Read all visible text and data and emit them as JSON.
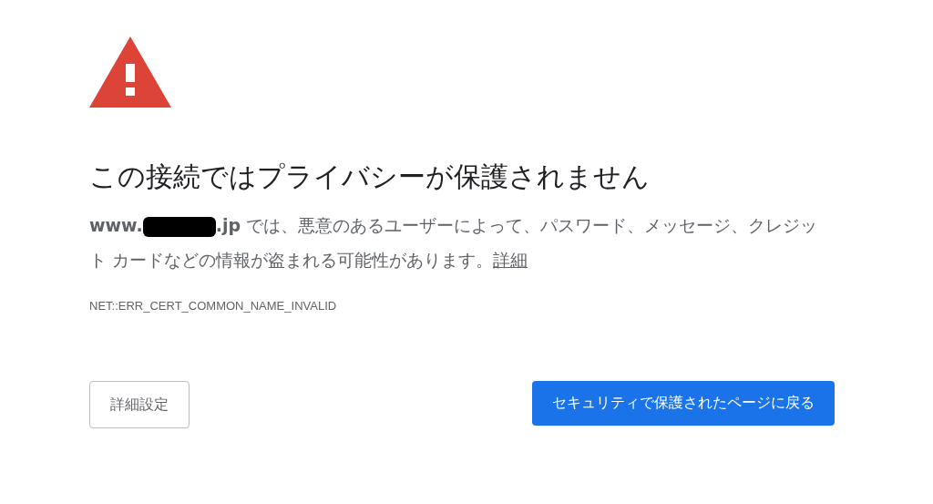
{
  "heading": "この接続ではプライバシーが保護されません",
  "message": {
    "domain_start": "www.",
    "redacted": true,
    "text": "**.jp** では、悪意のあるユーザーによって、パスワード、メッセージ、クレジット カードなどの情報が盗まれる可能性があります。",
    "link": "詳細"
  },
  "error_code": "NET::ERR_CERT_COMMON_NAME_INVALID",
  "buttons": [
    {
      "label": "詳細設定",
      "kind": "secondary"
    },
    {
      "label": "セキュリティで保護されたページに戻る",
      "kind": "primary"
    }
  ]
}
